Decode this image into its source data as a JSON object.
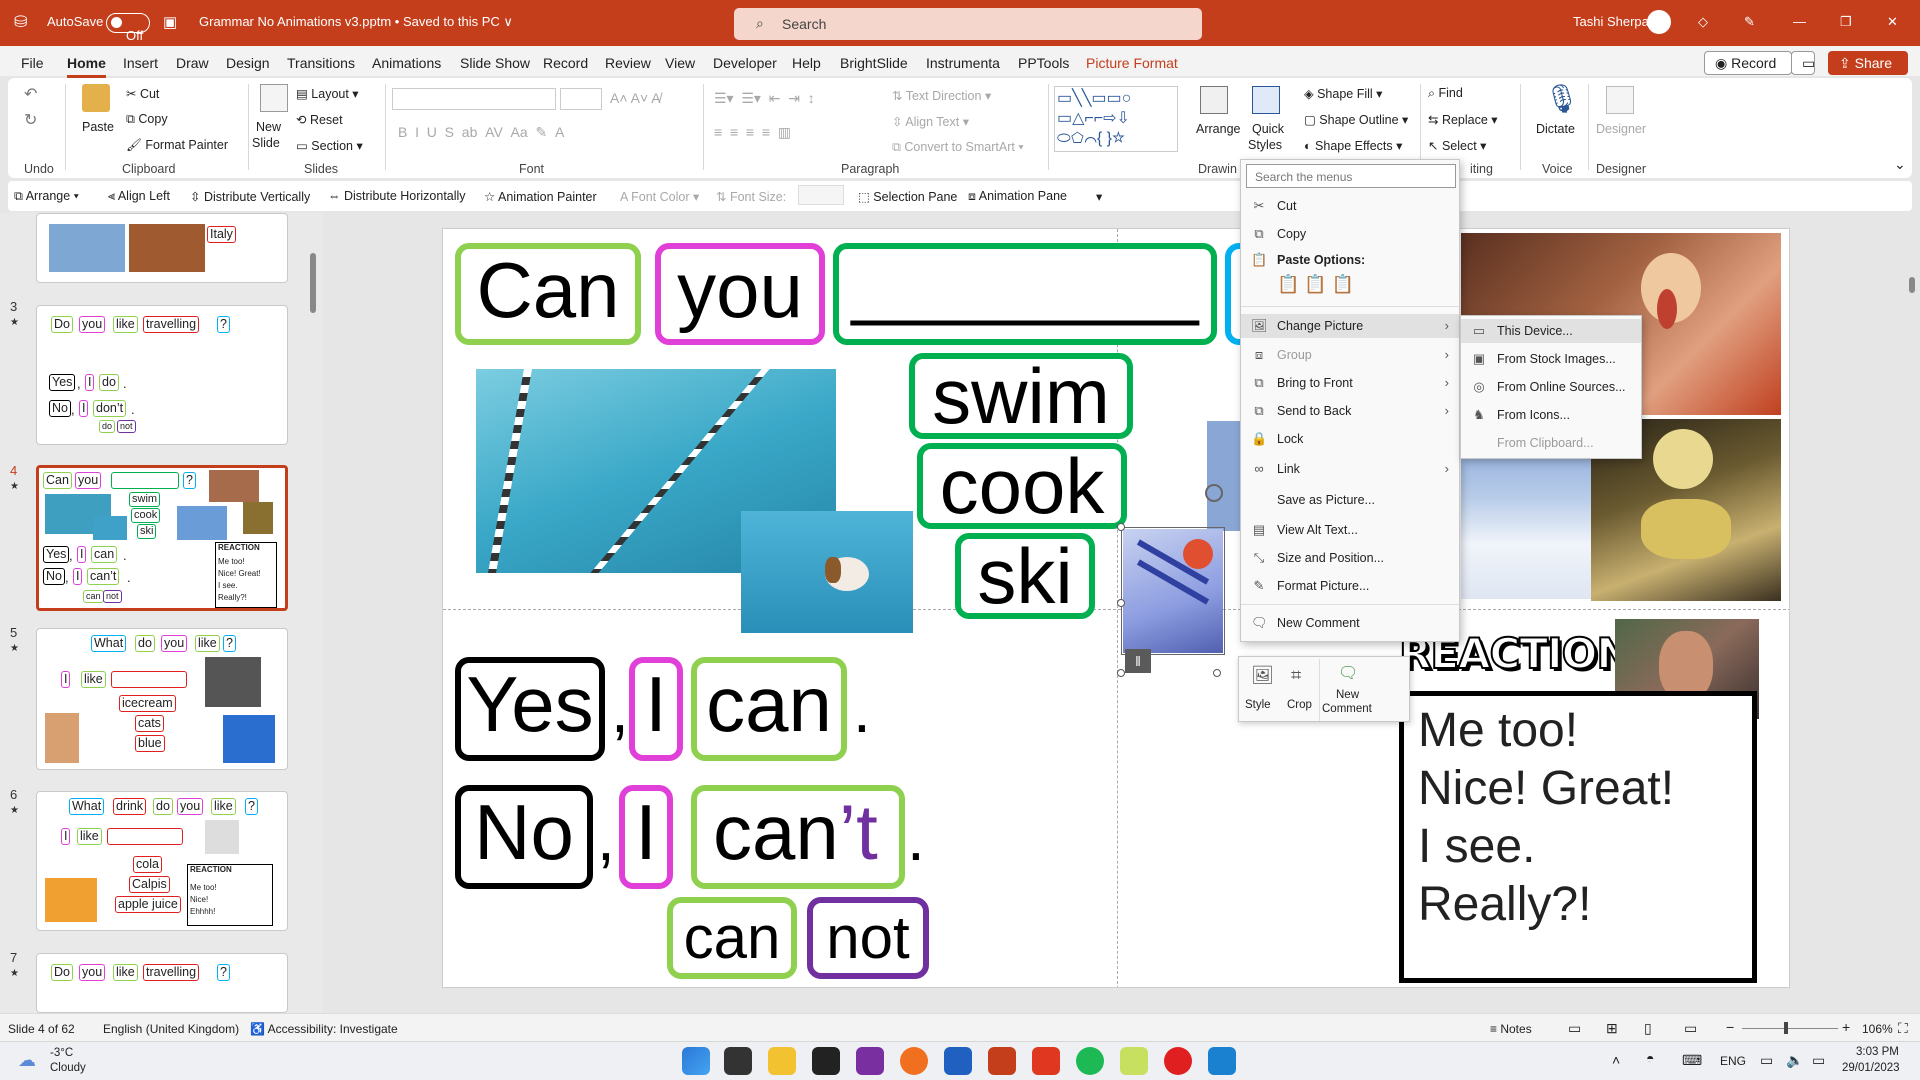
{
  "titlebar": {
    "autosave": "AutoSave",
    "toggle": "Off",
    "doc": "Grammar No Animations v3.pptm • Saved to this PC ∨",
    "search": "Search",
    "user": "Tashi Sherpa"
  },
  "tabs": [
    "File",
    "Home",
    "Insert",
    "Draw",
    "Design",
    "Transitions",
    "Animations",
    "Slide Show",
    "Record",
    "Review",
    "View",
    "Developer",
    "Help",
    "BrightSlide",
    "Instrumenta",
    "PPTools",
    "Picture Format"
  ],
  "tab_buttons": {
    "record": "Record",
    "share": "Share"
  },
  "ribbon": {
    "clipboard": {
      "paste": "Paste",
      "cut": "Cut",
      "copy": "Copy",
      "painter": "Format Painter",
      "group": "Clipboard"
    },
    "undo": {
      "group": "Undo"
    },
    "slides": {
      "new": "New",
      "slide": "Slide",
      "layout": "Layout",
      "reset": "Reset",
      "section": "Section",
      "group": "Slides"
    },
    "font": {
      "group": "Font"
    },
    "paragraph": {
      "textdir": "Text Direction",
      "align": "Align Text",
      "smartart": "Convert to SmartArt",
      "group": "Paragraph"
    },
    "drawing": {
      "arrange": "Arrange",
      "quick": "Quick",
      "styles": "Styles",
      "fill": "Shape Fill",
      "outline": "Shape Outline",
      "effects": "Shape Effects",
      "group": "Drawin"
    },
    "editing": {
      "find": "Find",
      "replace": "Replace",
      "select": "Select",
      "group": "iting"
    },
    "voice": {
      "dictate": "Dictate",
      "group": "Voice"
    },
    "designer": {
      "designer": "Designer",
      "group": "Designer"
    }
  },
  "qat": [
    "Arrange",
    "Align Left",
    "Distribute Vertically",
    "Distribute Horizontally",
    "Animation Painter",
    "Font Color",
    "Font Size:",
    "Selection Pane",
    "Animation Pane"
  ],
  "thumbs": {
    "t2": {
      "italy": "Italy"
    },
    "t3": {
      "num": "3",
      "q": [
        "Do",
        "you",
        "like",
        "travelling",
        "?"
      ],
      "yes": [
        "Yes",
        ",",
        "I",
        "do",
        "."
      ],
      "no": [
        "No",
        ",",
        "I",
        "don’t",
        "."
      ],
      "sub": [
        "do",
        "not"
      ]
    },
    "t4": {
      "num": "4",
      "q": [
        "Can",
        "you",
        "?"
      ],
      "verbs": [
        "swim",
        "cook",
        "ski"
      ],
      "yes": [
        "Yes",
        ",",
        "I",
        "can",
        "."
      ],
      "no": [
        "No",
        ",",
        "I",
        "can’t",
        "."
      ],
      "sub": [
        "can",
        "not"
      ],
      "reaction": "REACTION",
      "lines": [
        "Me too!",
        "Nice! Great!",
        "I see.",
        "Really?!"
      ]
    },
    "t5": {
      "num": "5",
      "q": [
        "What",
        "do",
        "you",
        "like",
        "?"
      ],
      "row": [
        "I",
        "like"
      ],
      "items": [
        "icecream",
        "cats",
        "blue"
      ]
    },
    "t6": {
      "num": "6",
      "q": [
        "What",
        "drink",
        "do",
        "you",
        "like",
        "?"
      ],
      "row": [
        "I",
        "like"
      ],
      "items": [
        "cola",
        "Calpis",
        "apple juice"
      ],
      "reaction": "REACTION",
      "lines": [
        "Me too!",
        "Nice!",
        "Ehhhh!"
      ]
    },
    "t7": {
      "num": "7",
      "q": [
        "Do",
        "you",
        "like",
        "travelling",
        "?"
      ]
    }
  },
  "slide": {
    "q": [
      "Can",
      "you",
      "________"
    ],
    "verbs": [
      "swim",
      "cook",
      "ski"
    ],
    "yes": [
      "Yes",
      ",",
      "I",
      "can",
      "."
    ],
    "no": [
      "No",
      ",",
      "I",
      "can",
      "’t",
      "."
    ],
    "sub": [
      "can",
      "not"
    ],
    "reaction": "REACTION",
    "lines": [
      "Me too!",
      "Nice! Great!",
      "I see.",
      "Really?!"
    ]
  },
  "context_menu": {
    "search": "Search the menus",
    "items": [
      "Cut",
      "Copy",
      "Paste Options:",
      "Change Picture",
      "Group",
      "Bring to Front",
      "Send to Back",
      "Lock",
      "Link",
      "Save as Picture...",
      "View Alt Text...",
      "Size and Position...",
      "Format Picture...",
      "New Comment"
    ]
  },
  "submenu": [
    "This Device...",
    "From Stock Images...",
    "From Online Sources...",
    "From Icons...",
    "From Clipboard..."
  ],
  "minitoolbar": {
    "style": "Style",
    "crop": "Crop",
    "new": "New",
    "comment": "Comment"
  },
  "status": {
    "slide": "Slide 4 of 62",
    "lang": "English (United Kingdom)",
    "access": "Accessibility: Investigate",
    "notes": "Notes",
    "zoom": "106%"
  },
  "taskbar": {
    "temp": "-3°C",
    "weather": "Cloudy",
    "lang": "ENG",
    "time": "3:03 PM",
    "date": "29/01/2023"
  },
  "colors": {
    "brand": "#c43e1c",
    "green": "#8fd14f",
    "pink": "#e040d8",
    "dgreen": "#00b050",
    "black": "#000000",
    "purple": "#7030a0",
    "blue": "#00b0f0",
    "red": "#e02020"
  }
}
